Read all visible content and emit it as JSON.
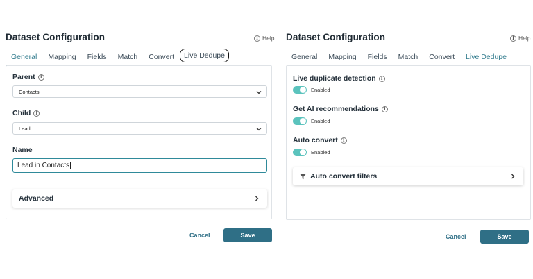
{
  "left": {
    "title": "Dataset Configuration",
    "help": "Help",
    "tabs": [
      "General",
      "Mapping",
      "Fields",
      "Match",
      "Convert",
      "Live Dedupe"
    ],
    "active_tab": "General",
    "parent_label": "Parent",
    "parent_value": "Contacts",
    "child_label": "Child",
    "child_value": "Lead",
    "name_label": "Name",
    "name_value": "Lead in Contacts",
    "advanced_label": "Advanced",
    "cancel": "Cancel",
    "save": "Save"
  },
  "right": {
    "title": "Dataset Configuration",
    "help": "Help",
    "tabs": [
      "General",
      "Mapping",
      "Fields",
      "Match",
      "Convert",
      "Live Dedupe"
    ],
    "active_tab": "Live Dedupe",
    "toggles": [
      {
        "label": "Live duplicate detection",
        "state": "Enabled"
      },
      {
        "label": "Get AI recommendations",
        "state": "Enabled"
      },
      {
        "label": "Auto convert",
        "state": "Enabled"
      }
    ],
    "filters_label": "Auto convert filters",
    "cancel": "Cancel",
    "save": "Save"
  },
  "colors": {
    "accent": "#2f7a8c",
    "toggle_on": "#5bc3bd",
    "save_button": "#2f6f86"
  },
  "icons": [
    "info-icon",
    "chevron-down-icon",
    "chevron-right-icon",
    "filter-icon"
  ]
}
